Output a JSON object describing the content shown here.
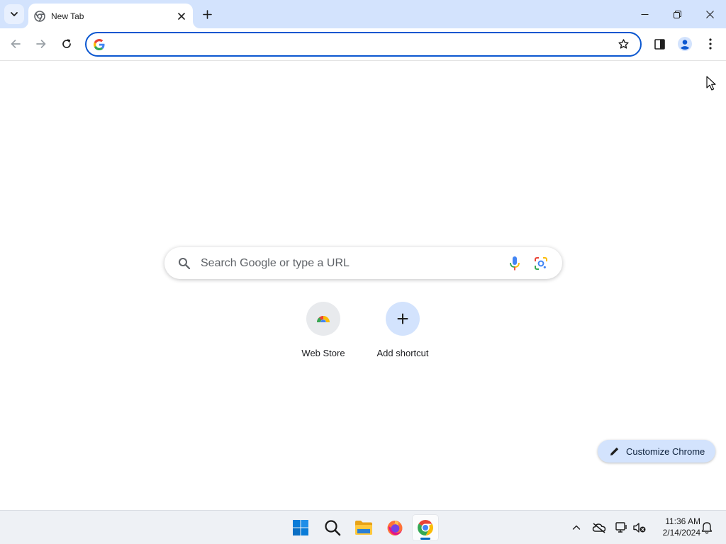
{
  "browser": {
    "tab": {
      "title": "New Tab"
    },
    "omnibox": {
      "value": "",
      "placeholder": ""
    }
  },
  "ntp": {
    "search": {
      "placeholder": "Search Google or type a URL"
    },
    "shortcuts": [
      {
        "label": "Web Store",
        "icon": "chrome-web-store-icon"
      },
      {
        "label": "Add shortcut",
        "icon": "plus-icon"
      }
    ],
    "customize": {
      "label": "Customize Chrome"
    }
  },
  "taskbar": {
    "apps": [
      "windows-start-icon",
      "search-icon",
      "file-explorer-icon",
      "firefox-icon",
      "chrome-icon"
    ],
    "active_app": "chrome-icon",
    "clock": {
      "time": "11:36 AM",
      "date": "2/14/2024"
    }
  },
  "colors": {
    "titlebar": "#d3e3fd",
    "accent": "#0b57d0",
    "customize_bg": "#d3e3fd",
    "taskbar": "#eef1f5"
  }
}
